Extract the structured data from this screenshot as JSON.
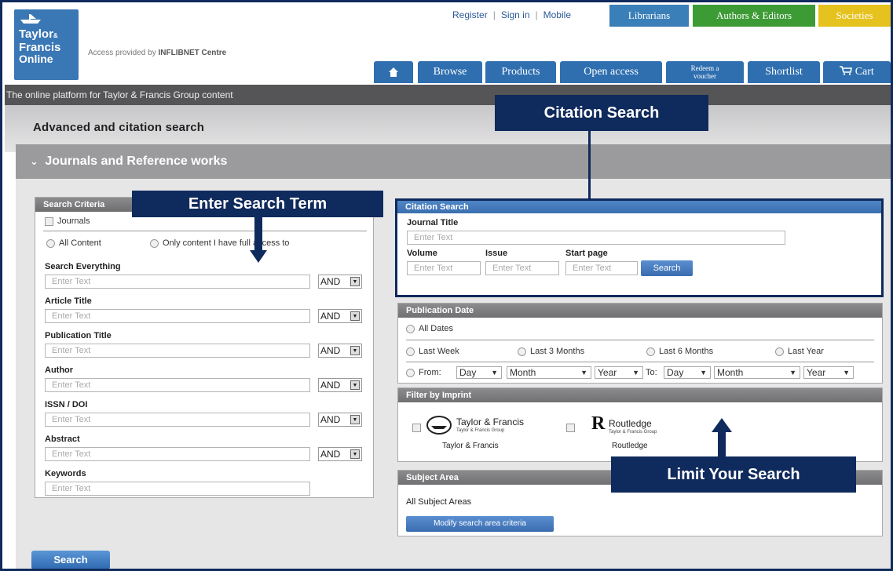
{
  "header": {
    "logo_lines": [
      "Taylor",
      "Francis",
      "Online"
    ],
    "logo_amp": "&",
    "access_prefix": "Access provided by",
    "access_org": "INFLIBNET Centre",
    "top_links": [
      "Register",
      "Sign in",
      "Mobile"
    ],
    "top_tabs": {
      "librarians": "Librarians",
      "authors": "Authors & Editors",
      "societies": "Societies"
    },
    "nav": {
      "browse": "Browse",
      "products": "Products",
      "open_access": "Open access",
      "voucher_1": "Redeem a",
      "voucher_2": "voucher",
      "shortlist": "Shortlist",
      "cart": "Cart"
    },
    "tagline": "The online platform for Taylor & Francis Group content"
  },
  "page": {
    "title": "Advanced and citation search",
    "section": "Journals and Reference works"
  },
  "search_criteria": {
    "heading": "Search Criteria",
    "journals_checkbox": "Journals",
    "scope_all": "All Content",
    "scope_access": "Only content I have full access to",
    "placeholder": "Enter Text",
    "operator": "AND",
    "fields": {
      "everything": "Search Everything",
      "article_title": "Article Title",
      "publication_title": "Publication Title",
      "author": "Author",
      "issn_doi": "ISSN / DOI",
      "abstract": "Abstract",
      "keywords": "Keywords"
    }
  },
  "citation": {
    "heading": "Citation Search",
    "journal_title": "Journal Title",
    "volume": "Volume",
    "issue": "Issue",
    "start_page": "Start page",
    "button": "Search"
  },
  "publication_date": {
    "heading": "Publication Date",
    "all_dates": "All Dates",
    "last_week": "Last Week",
    "last_3": "Last 3 Months",
    "last_6": "Last 6 Months",
    "last_year": "Last Year",
    "from": "From:",
    "to": "To:",
    "day": "Day",
    "month": "Month",
    "year": "Year"
  },
  "imprint": {
    "heading": "Filter by Imprint",
    "tf_logo": "Taylor & Francis",
    "tf_logo_sub": "Taylor & Francis Group",
    "tf_label": "Taylor & Francis",
    "rt_logo": "Routledge",
    "rt_logo_sub": "Taylor & Francis Group",
    "rt_label": "Routledge"
  },
  "subject": {
    "heading": "Subject Area",
    "value": "All Subject Areas",
    "button": "Modify search area criteria"
  },
  "callouts": {
    "citation": "Citation Search",
    "enter_term": "Enter Search Term",
    "limit": "Limit Your Search"
  },
  "bottom_button": "Search",
  "colors": {
    "navy": "#0f2a5c",
    "nav_blue": "#2f6fb0",
    "green": "#3d9b36",
    "yellow": "#e6c21f"
  }
}
